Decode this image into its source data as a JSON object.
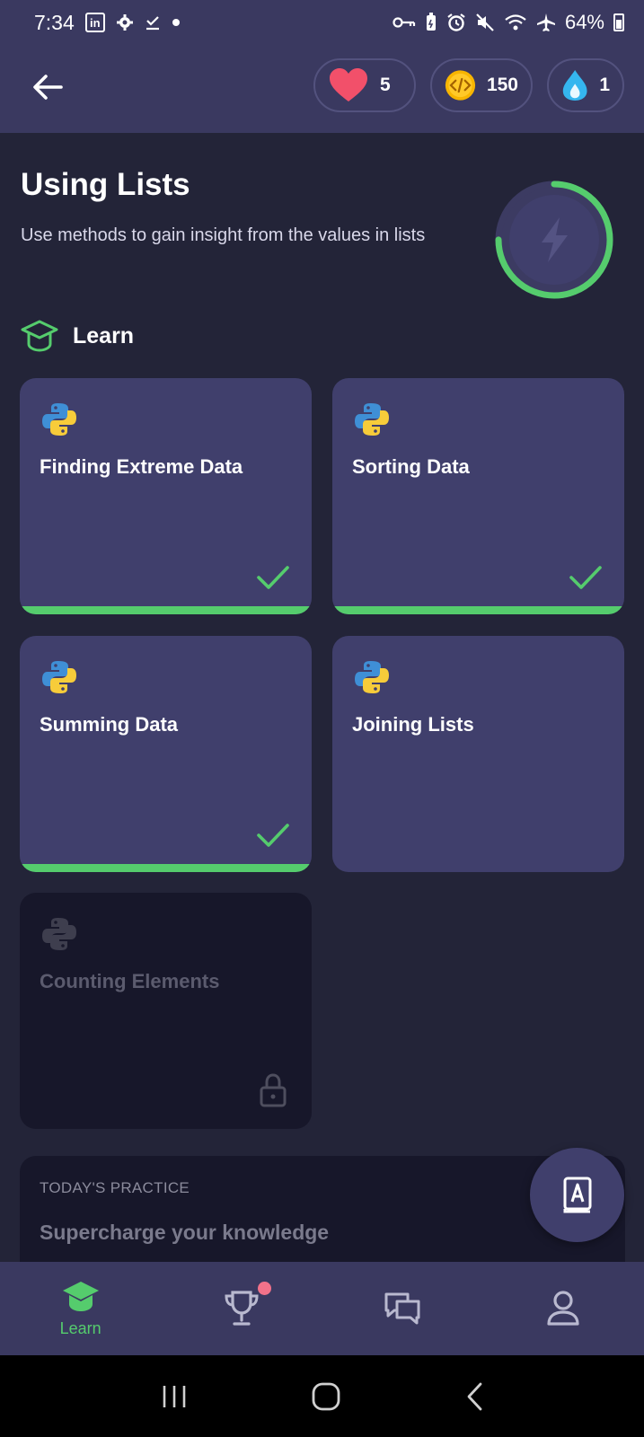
{
  "status_bar": {
    "time": "7:34",
    "battery": "64%",
    "app_icons": [
      "linkedin-icon",
      "settings-gear-icon",
      "checklist-icon",
      "dot-icon"
    ],
    "system_icons": [
      "vpn-key-icon",
      "battery-saver-icon",
      "alarm-icon",
      "mute-icon",
      "wifi-icon",
      "airplane-icon"
    ]
  },
  "header": {
    "hearts": "5",
    "coins": "150",
    "streak": "1"
  },
  "lesson": {
    "title": "Using Lists",
    "subtitle": "Use methods to gain insight from the values in lists",
    "progress": 0.75
  },
  "section": {
    "label": "Learn"
  },
  "cards": [
    {
      "title": "Finding Extreme Data",
      "status": "completed"
    },
    {
      "title": "Sorting Data",
      "status": "completed"
    },
    {
      "title": "Summing Data",
      "status": "completed"
    },
    {
      "title": "Joining Lists",
      "status": "available"
    },
    {
      "title": "Counting Elements",
      "status": "locked"
    }
  ],
  "practice": {
    "label": "TODAY'S PRACTICE",
    "title": "Supercharge your knowledge"
  },
  "bottom_nav": {
    "learn": "Learn"
  },
  "colors": {
    "accent_green": "#55cc6d",
    "header_bg": "#3a3960",
    "page_bg": "#232438",
    "card_bg": "#403f6c",
    "locked_bg": "#17172a",
    "heart": "#f2506a",
    "coin": "#f7b500",
    "streak": "#35b6ef",
    "notification": "#f2728a"
  }
}
